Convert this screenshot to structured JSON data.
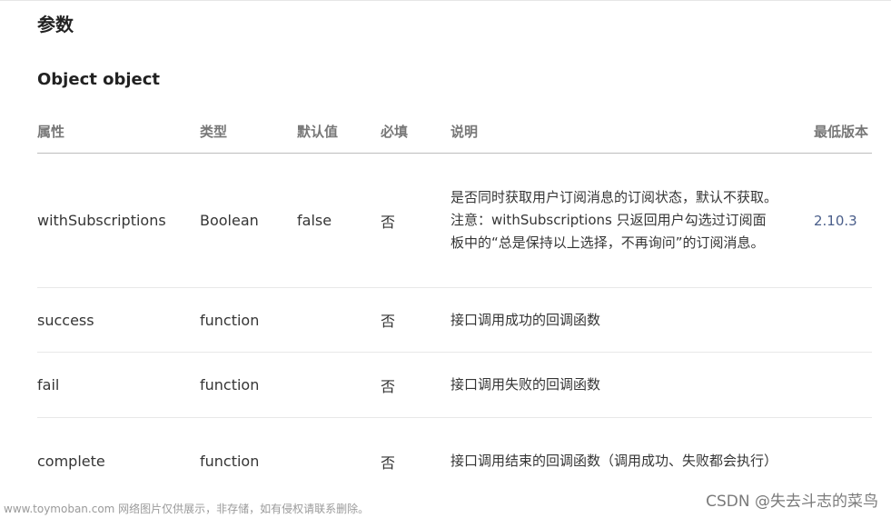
{
  "heading": "参数",
  "subheading": "Object object",
  "table": {
    "headers": [
      "属性",
      "类型",
      "默认值",
      "必填",
      "说明",
      "最低版本"
    ],
    "rows": [
      {
        "name": "withSubscriptions",
        "type": "Boolean",
        "default": "false",
        "required": "否",
        "description": "是否同时获取用户订阅消息的订阅状态，默认不获取。注意：withSubscriptions 只返回用户勾选过订阅面板中的“总是保持以上选择，不再询问”的订阅消息。",
        "version": "2.10.3"
      },
      {
        "name": "success",
        "type": "function",
        "default": "",
        "required": "否",
        "description": "接口调用成功的回调函数",
        "version": ""
      },
      {
        "name": "fail",
        "type": "function",
        "default": "",
        "required": "否",
        "description": "接口调用失败的回调函数",
        "version": ""
      },
      {
        "name": "complete",
        "type": "function",
        "default": "",
        "required": "否",
        "description": "接口调用结束的回调函数（调用成功、失败都会执行）",
        "version": ""
      }
    ]
  },
  "watermark_left": "www.toymoban.com 网络图片仅供展示，非存储，如有侵权请联系删除。",
  "watermark_right": "CSDN @失去斗志的菜鸟"
}
